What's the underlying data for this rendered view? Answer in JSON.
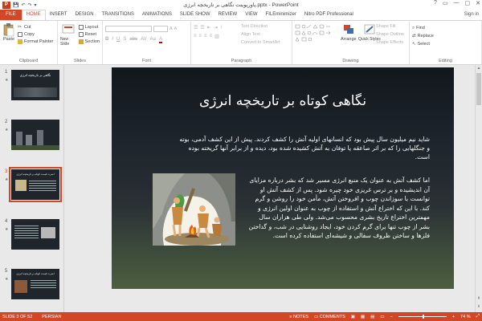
{
  "app": {
    "title": "پاورپوینت نگاهی بر تاریخچه انرژی.pptx - PowerPoint",
    "qat_items": [
      "💾",
      "↶",
      "↷",
      "▾"
    ],
    "window_controls": [
      "?",
      "▭",
      "—",
      "▢",
      "✕"
    ],
    "sign_in": "Sign in"
  },
  "tabs": [
    {
      "label": "FILE"
    },
    {
      "label": "HOME"
    },
    {
      "label": "INSERT"
    },
    {
      "label": "DESIGN"
    },
    {
      "label": "TRANSITIONS"
    },
    {
      "label": "ANIMATIONS"
    },
    {
      "label": "SLIDE SHOW"
    },
    {
      "label": "REVIEW"
    },
    {
      "label": "VIEW"
    },
    {
      "label": "FILEminimizer"
    },
    {
      "label": "Nitro PDF Professional"
    }
  ],
  "ribbon": {
    "clipboard": {
      "label": "Clipboard",
      "paste": "Paste",
      "cut": "Cut",
      "copy": "Copy",
      "format_painter": "Format Painter"
    },
    "slides": {
      "label": "Slides",
      "new_slide": "New Slide",
      "layout": "Layout",
      "reset": "Reset",
      "section": "Section"
    },
    "font": {
      "label": "Font"
    },
    "paragraph": {
      "label": "Paragraph",
      "text_direction": "Text Direction",
      "align_text": "Align Text",
      "convert_smartart": "Convert to SmartArt"
    },
    "drawing": {
      "label": "Drawing",
      "arrange": "Arrange",
      "quick_styles": "Quick Styles",
      "shape_fill": "Shape Fill",
      "shape_outline": "Shape Outline",
      "shape_effects": "Shape Effects"
    },
    "editing": {
      "label": "Editing",
      "find": "Find",
      "replace": "Replace",
      "select": "Select"
    }
  },
  "thumbnails": [
    {
      "num": "1",
      "title": "نگاهی بر تاریخچه انرژی"
    },
    {
      "num": "2",
      "title": ""
    },
    {
      "num": "3",
      "title": "اضرت قیمت کوتاه بر تاریخچه انرژی"
    },
    {
      "num": "4",
      "title": ""
    },
    {
      "num": "5",
      "title": "اضرت قیمت کوتاه بر تاریخچه انرژی"
    }
  ],
  "slide": {
    "title": "نگاهی کوتاه بر تاریخچه انرژی",
    "intro": "شاید نیم میلیون سال پیش بود که انسانهای اولیه آتش را کشف کردند. پیش از این کشف آدمی، بوته و جنگلهایی را که بر اثر صاعقه یا توفان به آتش کشیده شده بود، دیده و از برابر آنها گریخته بوده است.",
    "body": "اما کشف آتش به عنوان یک منبع انرژی مسیر شد که بشر درباره مزایای آن اندیشیده و بر ترس غریزی خود چیره شود. پس از کشف آتش او توانست با سوزاندن چوب و افروختن آتش، مأمن خود را روشن و گرم کند. با این که اختراع آتش و استفاده از چوب به عنوان اولین انرژی و مهمترین اختراع تاریخ بشری محسوب می‌شد. ولی طی هزاران سال بشر از چوب تنها برای گرم کردن خود، ایجاد روشنایی در شب، و گداختن فلزها و ساختن ظروف سفالی و شیشه‌ای استفاده کرده است."
  },
  "status": {
    "slide_info": "SLIDE 3 OF 52",
    "language": "PERSIAN",
    "notes": "NOTES",
    "comments": "COMMENTS",
    "zoom": "74 %"
  },
  "colors": {
    "accent": "#d24726"
  }
}
